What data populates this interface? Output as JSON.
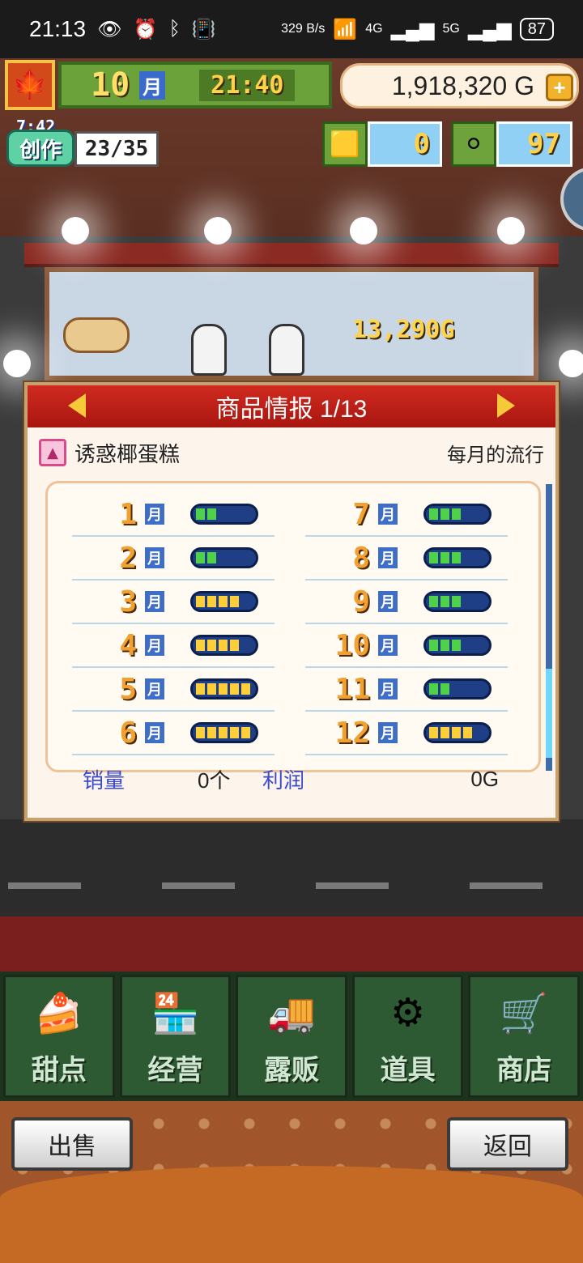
{
  "status_bar": {
    "time": "21:13",
    "net_speed": "329 B/s",
    "signal_1": "4G",
    "signal_2": "5G",
    "battery": "87"
  },
  "hud": {
    "month": "10",
    "month_unit": "月",
    "clock": "21:40",
    "money": "1,918,320 G",
    "craft_time": "7:42",
    "craft_label": "创作",
    "craft_count": "23/35",
    "gold_count": "0",
    "silver_count": "97"
  },
  "scene": {
    "sale_popup": "13,290G"
  },
  "dialog": {
    "title": "商品情报 1/13",
    "item_name": "诱惑椰蛋糕",
    "trend_label": "每月的流行",
    "months": [
      {
        "month": "1",
        "unit": "月",
        "level": 2,
        "color": "green"
      },
      {
        "month": "2",
        "unit": "月",
        "level": 2,
        "color": "green"
      },
      {
        "month": "3",
        "unit": "月",
        "level": 4,
        "color": "yellow"
      },
      {
        "month": "4",
        "unit": "月",
        "level": 4,
        "color": "yellow"
      },
      {
        "month": "5",
        "unit": "月",
        "level": 5,
        "color": "yellow"
      },
      {
        "month": "6",
        "unit": "月",
        "level": 5,
        "color": "yellow"
      },
      {
        "month": "7",
        "unit": "月",
        "level": 3,
        "color": "green"
      },
      {
        "month": "8",
        "unit": "月",
        "level": 3,
        "color": "green"
      },
      {
        "month": "9",
        "unit": "月",
        "level": 3,
        "color": "green"
      },
      {
        "month": "10",
        "unit": "月",
        "level": 3,
        "color": "green"
      },
      {
        "month": "11",
        "unit": "月",
        "level": 2,
        "color": "green"
      },
      {
        "month": "12",
        "unit": "月",
        "level": 4,
        "color": "yellow"
      }
    ],
    "sales_label": "销量",
    "sales_value": "0个",
    "profit_label": "利润",
    "profit_value": "0G"
  },
  "menu": {
    "items": [
      {
        "label": "甜点",
        "icon": "cake-icon"
      },
      {
        "label": "经营",
        "icon": "shop-icon"
      },
      {
        "label": "露贩",
        "icon": "food-truck-icon"
      },
      {
        "label": "道具",
        "icon": "gear-bag-icon"
      },
      {
        "label": "商店",
        "icon": "cart-icon"
      }
    ]
  },
  "actions": {
    "sell": "出售",
    "back": "返回"
  }
}
